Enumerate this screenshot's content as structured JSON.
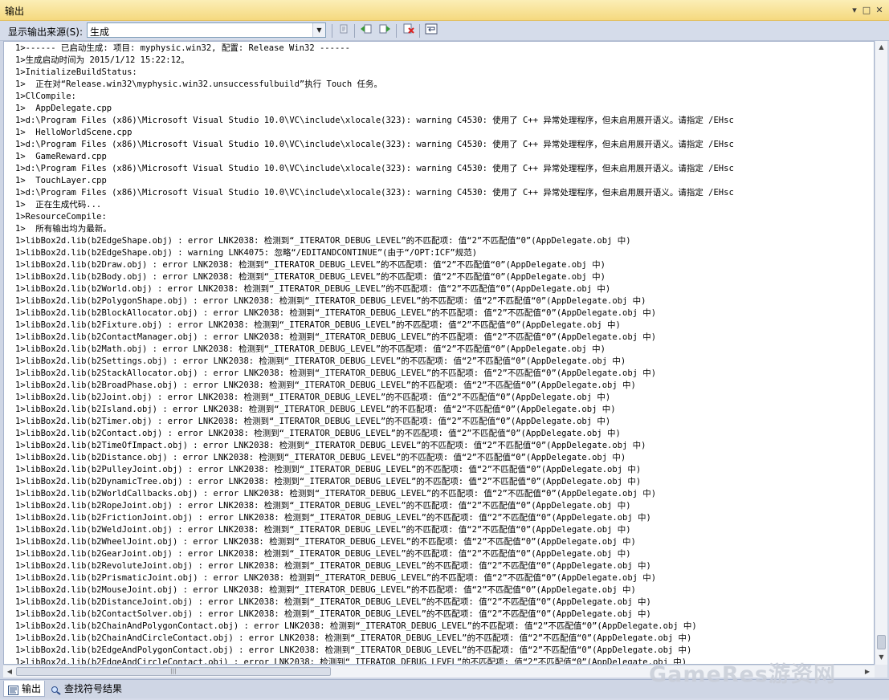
{
  "window": {
    "title": "输出",
    "pin_glyph": "▾",
    "restore_glyph": "□",
    "close_glyph": "✕"
  },
  "toolbar": {
    "source_label": "显示输出来源(S):",
    "source_value": "生成"
  },
  "output_lines": [
    "1>------ 已启动生成: 项目: myphysic.win32, 配置: Release Win32 ------",
    "1>生成启动时间为 2015/1/12 15:22:12。",
    "1>InitializeBuildStatus:",
    "1>  正在对“Release.win32\\myphysic.win32.unsuccessfulbuild”执行 Touch 任务。",
    "1>ClCompile:",
    "1>  AppDelegate.cpp",
    "1>d:\\Program Files (x86)\\Microsoft Visual Studio 10.0\\VC\\include\\xlocale(323): warning C4530: 使用了 C++ 异常处理程序，但未启用展开语义。请指定 /EHsc",
    "1>  HelloWorldScene.cpp",
    "1>d:\\Program Files (x86)\\Microsoft Visual Studio 10.0\\VC\\include\\xlocale(323): warning C4530: 使用了 C++ 异常处理程序，但未启用展开语义。请指定 /EHsc",
    "1>  GameReward.cpp",
    "1>d:\\Program Files (x86)\\Microsoft Visual Studio 10.0\\VC\\include\\xlocale(323): warning C4530: 使用了 C++ 异常处理程序，但未启用展开语义。请指定 /EHsc",
    "1>  TouchLayer.cpp",
    "1>d:\\Program Files (x86)\\Microsoft Visual Studio 10.0\\VC\\include\\xlocale(323): warning C4530: 使用了 C++ 异常处理程序，但未启用展开语义。请指定 /EHsc",
    "1>  正在生成代码...",
    "1>ResourceCompile:",
    "1>  所有输出均为最新。",
    "1>libBox2d.lib(b2EdgeShape.obj) : error LNK2038: 检测到“_ITERATOR_DEBUG_LEVEL”的不匹配项: 值“2”不匹配值“0”(AppDelegate.obj 中)",
    "1>libBox2d.lib(b2EdgeShape.obj) : warning LNK4075: 忽略“/EDITANDCONTINUE”(由于“/OPT:ICF”规范)",
    "1>libBox2d.lib(b2Draw.obj) : error LNK2038: 检测到“_ITERATOR_DEBUG_LEVEL”的不匹配项: 值“2”不匹配值“0”(AppDelegate.obj 中)",
    "1>libBox2d.lib(b2Body.obj) : error LNK2038: 检测到“_ITERATOR_DEBUG_LEVEL”的不匹配项: 值“2”不匹配值“0”(AppDelegate.obj 中)",
    "1>libBox2d.lib(b2World.obj) : error LNK2038: 检测到“_ITERATOR_DEBUG_LEVEL”的不匹配项: 值“2”不匹配值“0”(AppDelegate.obj 中)",
    "1>libBox2d.lib(b2PolygonShape.obj) : error LNK2038: 检测到“_ITERATOR_DEBUG_LEVEL”的不匹配项: 值“2”不匹配值“0”(AppDelegate.obj 中)",
    "1>libBox2d.lib(b2BlockAllocator.obj) : error LNK2038: 检测到“_ITERATOR_DEBUG_LEVEL”的不匹配项: 值“2”不匹配值“0”(AppDelegate.obj 中)",
    "1>libBox2d.lib(b2Fixture.obj) : error LNK2038: 检测到“_ITERATOR_DEBUG_LEVEL”的不匹配项: 值“2”不匹配值“0”(AppDelegate.obj 中)",
    "1>libBox2d.lib(b2ContactManager.obj) : error LNK2038: 检测到“_ITERATOR_DEBUG_LEVEL”的不匹配项: 值“2”不匹配值“0”(AppDelegate.obj 中)",
    "1>libBox2d.lib(b2Math.obj) : error LNK2038: 检测到“_ITERATOR_DEBUG_LEVEL”的不匹配项: 值“2”不匹配值“0”(AppDelegate.obj 中)",
    "1>libBox2d.lib(b2Settings.obj) : error LNK2038: 检测到“_ITERATOR_DEBUG_LEVEL”的不匹配项: 值“2”不匹配值“0”(AppDelegate.obj 中)",
    "1>libBox2d.lib(b2StackAllocator.obj) : error LNK2038: 检测到“_ITERATOR_DEBUG_LEVEL”的不匹配项: 值“2”不匹配值“0”(AppDelegate.obj 中)",
    "1>libBox2d.lib(b2BroadPhase.obj) : error LNK2038: 检测到“_ITERATOR_DEBUG_LEVEL”的不匹配项: 值“2”不匹配值“0”(AppDelegate.obj 中)",
    "1>libBox2d.lib(b2Joint.obj) : error LNK2038: 检测到“_ITERATOR_DEBUG_LEVEL”的不匹配项: 值“2”不匹配值“0”(AppDelegate.obj 中)",
    "1>libBox2d.lib(b2Island.obj) : error LNK2038: 检测到“_ITERATOR_DEBUG_LEVEL”的不匹配项: 值“2”不匹配值“0”(AppDelegate.obj 中)",
    "1>libBox2d.lib(b2Timer.obj) : error LNK2038: 检测到“_ITERATOR_DEBUG_LEVEL”的不匹配项: 值“2”不匹配值“0”(AppDelegate.obj 中)",
    "1>libBox2d.lib(b2Contact.obj) : error LNK2038: 检测到“_ITERATOR_DEBUG_LEVEL”的不匹配项: 值“2”不匹配值“0”(AppDelegate.obj 中)",
    "1>libBox2d.lib(b2TimeOfImpact.obj) : error LNK2038: 检测到“_ITERATOR_DEBUG_LEVEL”的不匹配项: 值“2”不匹配值“0”(AppDelegate.obj 中)",
    "1>libBox2d.lib(b2Distance.obj) : error LNK2038: 检测到“_ITERATOR_DEBUG_LEVEL”的不匹配项: 值“2”不匹配值“0”(AppDelegate.obj 中)",
    "1>libBox2d.lib(b2PulleyJoint.obj) : error LNK2038: 检测到“_ITERATOR_DEBUG_LEVEL”的不匹配项: 值“2”不匹配值“0”(AppDelegate.obj 中)",
    "1>libBox2d.lib(b2DynamicTree.obj) : error LNK2038: 检测到“_ITERATOR_DEBUG_LEVEL”的不匹配项: 值“2”不匹配值“0”(AppDelegate.obj 中)",
    "1>libBox2d.lib(b2WorldCallbacks.obj) : error LNK2038: 检测到“_ITERATOR_DEBUG_LEVEL”的不匹配项: 值“2”不匹配值“0”(AppDelegate.obj 中)",
    "1>libBox2d.lib(b2RopeJoint.obj) : error LNK2038: 检测到“_ITERATOR_DEBUG_LEVEL”的不匹配项: 值“2”不匹配值“0”(AppDelegate.obj 中)",
    "1>libBox2d.lib(b2FrictionJoint.obj) : error LNK2038: 检测到“_ITERATOR_DEBUG_LEVEL”的不匹配项: 值“2”不匹配值“0”(AppDelegate.obj 中)",
    "1>libBox2d.lib(b2WeldJoint.obj) : error LNK2038: 检测到“_ITERATOR_DEBUG_LEVEL”的不匹配项: 值“2”不匹配值“0”(AppDelegate.obj 中)",
    "1>libBox2d.lib(b2WheelJoint.obj) : error LNK2038: 检测到“_ITERATOR_DEBUG_LEVEL”的不匹配项: 值“2”不匹配值“0”(AppDelegate.obj 中)",
    "1>libBox2d.lib(b2GearJoint.obj) : error LNK2038: 检测到“_ITERATOR_DEBUG_LEVEL”的不匹配项: 值“2”不匹配值“0”(AppDelegate.obj 中)",
    "1>libBox2d.lib(b2RevoluteJoint.obj) : error LNK2038: 检测到“_ITERATOR_DEBUG_LEVEL”的不匹配项: 值“2”不匹配值“0”(AppDelegate.obj 中)",
    "1>libBox2d.lib(b2PrismaticJoint.obj) : error LNK2038: 检测到“_ITERATOR_DEBUG_LEVEL”的不匹配项: 值“2”不匹配值“0”(AppDelegate.obj 中)",
    "1>libBox2d.lib(b2MouseJoint.obj) : error LNK2038: 检测到“_ITERATOR_DEBUG_LEVEL”的不匹配项: 值“2”不匹配值“0”(AppDelegate.obj 中)",
    "1>libBox2d.lib(b2DistanceJoint.obj) : error LNK2038: 检测到“_ITERATOR_DEBUG_LEVEL”的不匹配项: 值“2”不匹配值“0”(AppDelegate.obj 中)",
    "1>libBox2d.lib(b2ContactSolver.obj) : error LNK2038: 检测到“_ITERATOR_DEBUG_LEVEL”的不匹配项: 值“2”不匹配值“0”(AppDelegate.obj 中)",
    "1>libBox2d.lib(b2ChainAndPolygonContact.obj) : error LNK2038: 检测到“_ITERATOR_DEBUG_LEVEL”的不匹配项: 值“2”不匹配值“0”(AppDelegate.obj 中)",
    "1>libBox2d.lib(b2ChainAndCircleContact.obj) : error LNK2038: 检测到“_ITERATOR_DEBUG_LEVEL”的不匹配项: 值“2”不匹配值“0”(AppDelegate.obj 中)",
    "1>libBox2d.lib(b2EdgeAndPolygonContact.obj) : error LNK2038: 检测到“_ITERATOR_DEBUG_LEVEL”的不匹配项: 值“2”不匹配值“0”(AppDelegate.obj 中)",
    "1>libBox2d.lib(b2EdgeAndCircleContact.obj) : error LNK2038: 检测到“_ITERATOR_DEBUG_LEVEL”的不匹配项: 值“2”不匹配值“0”(AppDelegate.obj 中)"
  ],
  "tabs": [
    {
      "label": "输出",
      "icon": "output-icon"
    },
    {
      "label": "查找符号结果",
      "icon": "find-symbol-icon"
    }
  ],
  "watermark": "GameRes游资网"
}
